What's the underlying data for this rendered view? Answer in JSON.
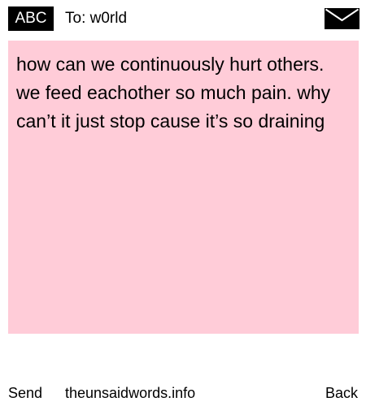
{
  "header": {
    "input_mode": "ABC",
    "to_label": "To: w0rld",
    "icon": "envelope-icon"
  },
  "message": {
    "text": "how can we continuously hurt others. we feed eachother so much pain. why can’t it just stop cause it’s so draining",
    "background_color": "#ffccd8"
  },
  "footer": {
    "send_label": "Send",
    "site_label": "theunsaidwords.info",
    "back_label": "Back"
  }
}
